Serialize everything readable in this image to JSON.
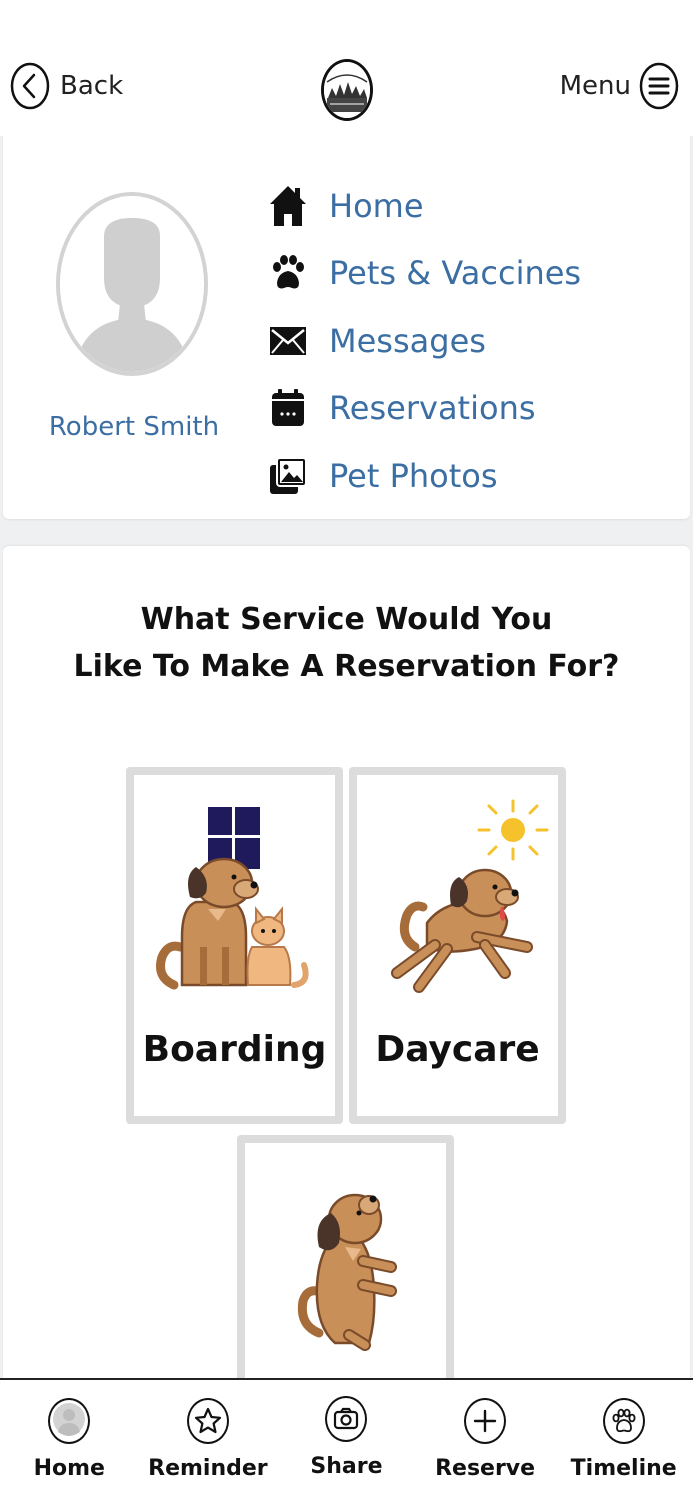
{
  "header": {
    "back_label": "Back",
    "menu_label": "Menu"
  },
  "profile": {
    "name": "Robert Smith",
    "nav": [
      {
        "label": "Home",
        "icon": "home-icon"
      },
      {
        "label": "Pets & Vaccines",
        "icon": "paw-icon"
      },
      {
        "label": "Messages",
        "icon": "envelope-icon"
      },
      {
        "label": "Reservations",
        "icon": "calendar-icon"
      },
      {
        "label": "Pet Photos",
        "icon": "photos-icon"
      }
    ]
  },
  "service": {
    "title_line1": "What Service Would You",
    "title_line2": "Like To Make A Reservation For?",
    "options": [
      {
        "label": "Boarding",
        "icon": "boarding-dog-icon"
      },
      {
        "label": "Daycare",
        "icon": "daycare-dog-icon"
      },
      {
        "label": "",
        "icon": "sitting-dog-icon"
      }
    ]
  },
  "tabs": [
    {
      "label": "Home",
      "icon": "user-icon"
    },
    {
      "label": "Reminder",
      "icon": "star-icon"
    },
    {
      "label": "Share",
      "icon": "camera-icon"
    },
    {
      "label": "Reserve",
      "icon": "plus-icon"
    },
    {
      "label": "Timeline",
      "icon": "paw-icon"
    }
  ],
  "colors": {
    "link_blue": "#3b6ea3",
    "tile_border": "#dcdcdc",
    "dog_brown": "#c98f58",
    "ear_dark": "#4a3328",
    "night_window": "#1f1a5c",
    "sun": "#f5c22b"
  }
}
